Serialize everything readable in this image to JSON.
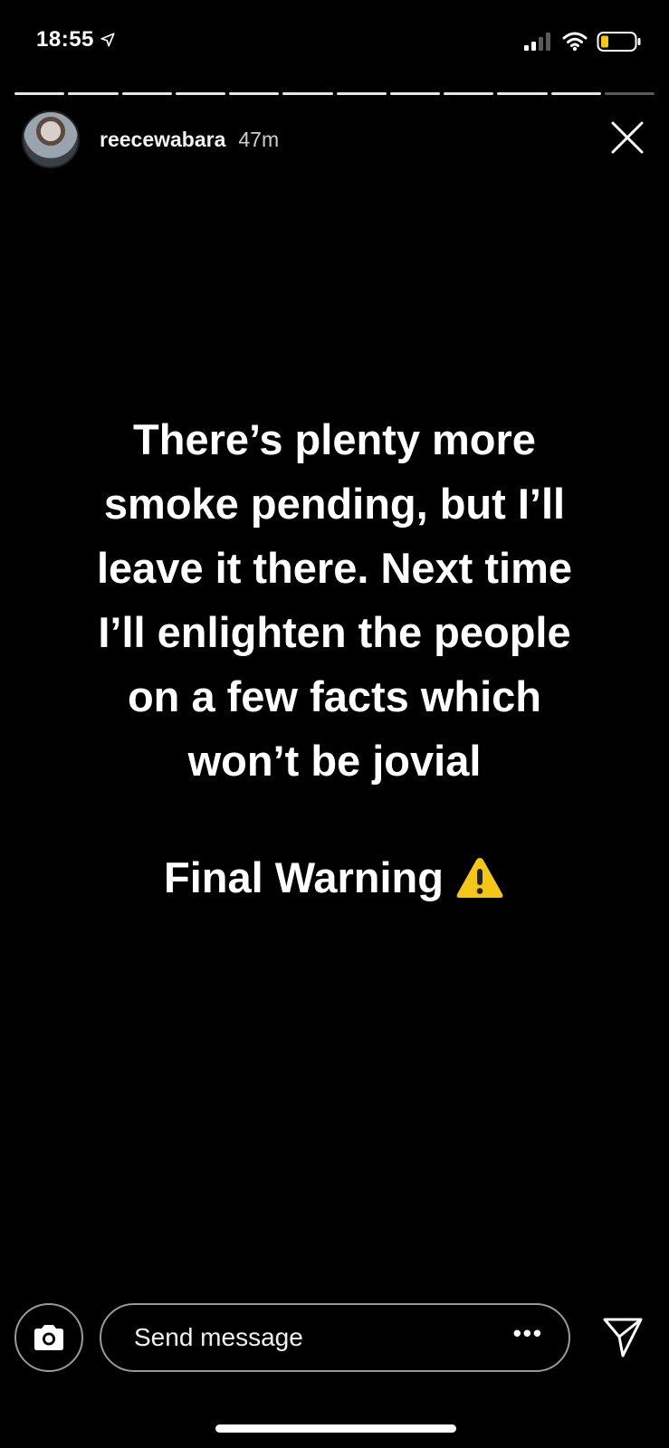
{
  "status_bar": {
    "time": "18:55",
    "icons": [
      "location-arrow-icon",
      "signal-icon",
      "wifi-icon",
      "battery-icon"
    ],
    "battery_color": "#f5c518"
  },
  "progress": {
    "segments": 12,
    "filled": 11
  },
  "header": {
    "username": "reecewabara",
    "time_ago": "47m",
    "close_icon": "close-icon"
  },
  "story": {
    "text": "There’s plenty more\nsmoke pending, but I’ll\nleave it there. Next time\nI’ll enlighten the people\non a few facts which\nwon’t be jovial",
    "warning": "Final Warning",
    "warning_icon": "warning-sign-icon",
    "warning_color": "#f5c518",
    "background": "#000000",
    "text_color": "#ffffff"
  },
  "composer": {
    "camera_icon": "camera-icon",
    "placeholder": "Send message",
    "more_icon": "more-dots-icon",
    "send_icon": "send-icon"
  }
}
